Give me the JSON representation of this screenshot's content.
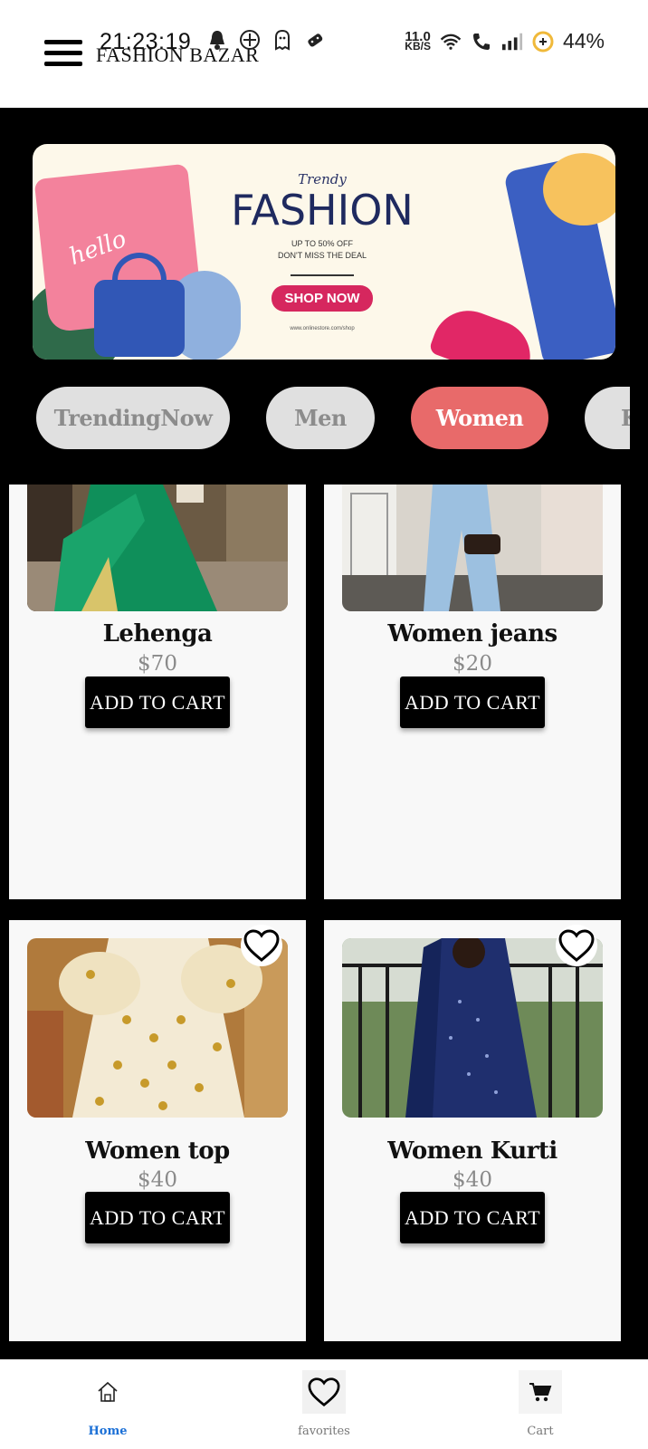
{
  "status_bar": {
    "time": "21:23:19",
    "net_speed_value": "11.0",
    "net_speed_unit": "KB/S",
    "battery_percent": "44%",
    "icons": [
      "notification-icon",
      "vpn-icon",
      "ghost-icon",
      "game-icon",
      "wifi-icon",
      "call-icon",
      "signal-icon",
      "battery-icon"
    ]
  },
  "app_bar": {
    "title": "FASHION BAZAR",
    "menu_icon": "hamburger-menu-icon"
  },
  "banner": {
    "kicker": "Trendy",
    "title": "FASHION",
    "subtitle_line1": "UP TO 50% OFF",
    "subtitle_line2": "DON'T MISS THE DEAL",
    "button": "SHOP NOW",
    "url": "www.onlinestore.com/shop",
    "shirt_text": "hello"
  },
  "categories": [
    {
      "label": "TrendingNow",
      "active": false
    },
    {
      "label": "Men",
      "active": false
    },
    {
      "label": "Women",
      "active": true
    },
    {
      "label": "K",
      "active": false
    }
  ],
  "products": [
    {
      "name": "Lehenga",
      "price": "$70",
      "button": "ADD TO CART"
    },
    {
      "name": "Women jeans",
      "price": "$20",
      "button": "ADD TO CART"
    },
    {
      "name": "Women top",
      "price": "$40",
      "button": "ADD TO CART"
    },
    {
      "name": "Women Kurti",
      "price": "$40",
      "button": "ADD TO CART"
    }
  ],
  "bottom_nav": [
    {
      "label": "Home",
      "icon": "home-icon",
      "active": true
    },
    {
      "label": "favorites",
      "icon": "heart-icon",
      "active": false
    },
    {
      "label": "Cart",
      "icon": "cart-icon",
      "active": false
    }
  ],
  "colors": {
    "accent_pill": "#e86a6a",
    "pill_inactive": "#e0e0e0",
    "nav_active": "#1a6fd6",
    "page_background": "#000000",
    "card_background": "#f8f8f8"
  }
}
